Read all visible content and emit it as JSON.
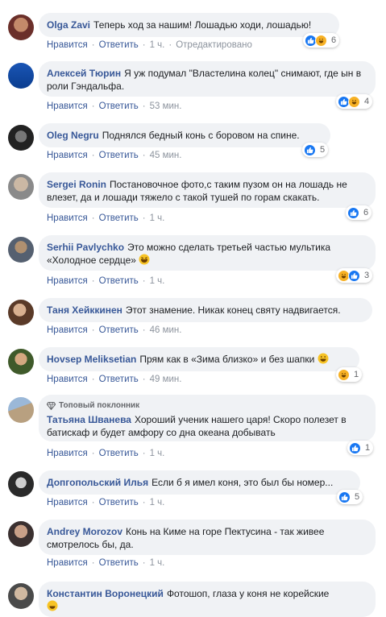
{
  "labels": {
    "like": "Нравится",
    "reply": "Ответить",
    "edited": "Отредактировано",
    "sep": "·"
  },
  "comments": [
    {
      "author": "Olga Zavi",
      "text": "Теперь ход за нашим! Лошадью ходи, лошадью!",
      "time": "1 ч.",
      "edited": true,
      "reactions": [
        "like",
        "haha"
      ],
      "count": "6"
    },
    {
      "author": "Алексей Тюрин",
      "text": "Я уж подумал \"Властелина колец\" снимают, где ын в роли Гэндальфа.",
      "time": "53 мин.",
      "reactions": [
        "like",
        "haha"
      ],
      "count": "4"
    },
    {
      "author": "Oleg Negru",
      "text": "Поднялся бедный конь с боровом на спине.",
      "time": "45 мин.",
      "reactions": [
        "like"
      ],
      "count": "5"
    },
    {
      "author": "Sergei Ronin",
      "text": "Постановочное фото,с таким пузом он на лошадь не влезет, да и лошади тяжело с такой тушей по горам скакать.",
      "time": "1 ч.",
      "reactions": [
        "like"
      ],
      "count": "6"
    },
    {
      "author": "Serhii Pavlychko",
      "text": "Это можно сделать третьей частью мультика «Холодное сердце»",
      "time": "1 ч.",
      "reactions": [
        "haha",
        "like"
      ],
      "count": "3"
    },
    {
      "author": "Таня Хейккинен",
      "text": "Этот знамение. Никак конец святу надвигается.",
      "time": "46 мин."
    },
    {
      "author": "Hovsep Meliksetian",
      "text": "Прям как в «Зима близко» и без шапки",
      "time": "49 мин.",
      "reactions": [
        "haha"
      ],
      "count": "1"
    },
    {
      "badge": "Топовый поклонник",
      "author": "Татьяна Шванева",
      "text": "Хороший ученик нашего царя! Скоро полезет в батискаф и будет амфору со дна океана добывать",
      "time": "1 ч.",
      "reactions": [
        "like"
      ],
      "count": "1"
    },
    {
      "author": "Допгопольский Илья",
      "text": "Если б я имел коня, это был бы номер...",
      "time": "1 ч.",
      "reactions": [
        "like"
      ],
      "count": "5"
    },
    {
      "author": "Andrey Morozov",
      "text": "Конь на Киме на горе Пектусина - так живее смотрелось бы, да.",
      "time": "1 ч."
    },
    {
      "author": "Константин Воронецкий",
      "text": "Фотошоп, глаза у коня не корейские"
    }
  ]
}
